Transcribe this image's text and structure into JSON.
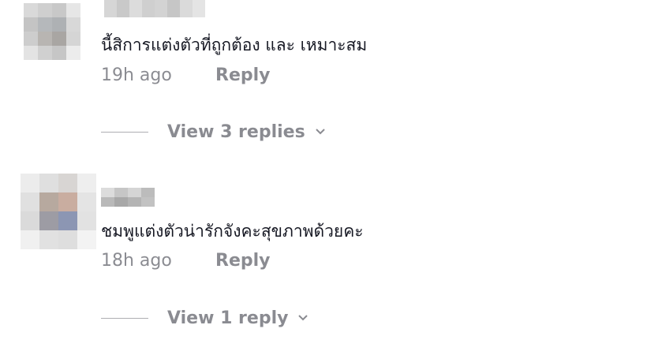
{
  "colors": {
    "text_primary": "#161823",
    "text_secondary": "rgba(22,24,35,0.5)"
  },
  "comments": [
    {
      "text": "นี้สิการแต่งตัวที่ถูกต้อง และ เหมาะสม",
      "time": "19h ago",
      "reply_label": "Reply",
      "view_replies_label": "View 3 replies",
      "avatar_icon": "blurred-avatar",
      "chevron_icon": "chevron-down-icon"
    },
    {
      "text": "ชมพูแต่งตัวน่ารักจังคะสุขภาพด้วยคะ",
      "time": "18h ago",
      "reply_label": "Reply",
      "view_replies_label": "View 1 reply",
      "avatar_icon": "blurred-avatar",
      "chevron_icon": "chevron-down-icon"
    }
  ]
}
